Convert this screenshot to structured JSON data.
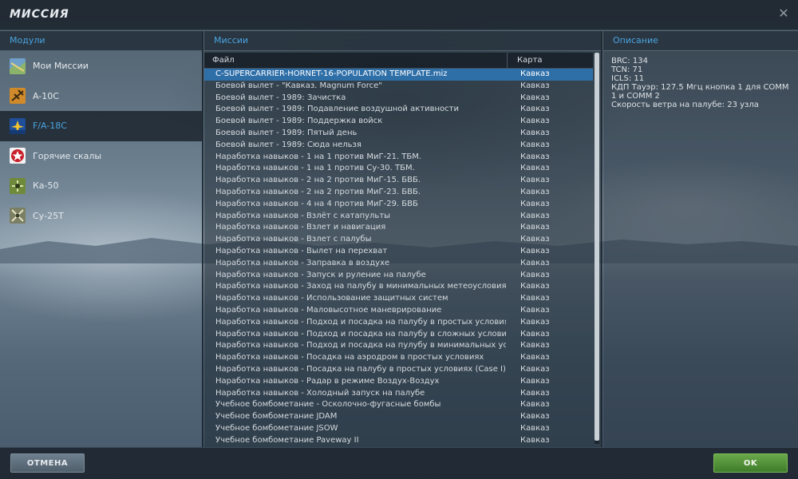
{
  "window": {
    "title": "МИССИЯ",
    "close_icon": "close-icon"
  },
  "columns": {
    "modules": "Модули",
    "missions": "Миссии",
    "description": "Описание"
  },
  "modules": [
    {
      "label": "Мои Миссии",
      "icon": "map-icon",
      "selected": false
    },
    {
      "label": "A-10C",
      "icon": "a10c-icon",
      "selected": false
    },
    {
      "label": "F/A-18C",
      "icon": "hornet-icon",
      "selected": true
    },
    {
      "label": "Горячие скалы",
      "icon": "star-icon",
      "selected": false
    },
    {
      "label": "Ка-50",
      "icon": "ka50-icon",
      "selected": false
    },
    {
      "label": "Су-25Т",
      "icon": "su25t-icon",
      "selected": false
    }
  ],
  "table": {
    "headers": {
      "file": "Файл",
      "map": "Карта"
    },
    "rows": [
      {
        "file": "C-SUPERCARRIER-HORNET-16-POPULATION TEMPLATE.miz",
        "map": "Кавказ",
        "selected": true
      },
      {
        "file": "Боевой вылет - \"Кавказ. Magnum Force\"",
        "map": "Кавказ"
      },
      {
        "file": "Боевой вылет - 1989: Зачистка",
        "map": "Кавказ"
      },
      {
        "file": "Боевой вылет - 1989: Подавление воздушной активности",
        "map": "Кавказ"
      },
      {
        "file": "Боевой вылет - 1989: Поддержка войск",
        "map": "Кавказ"
      },
      {
        "file": "Боевой вылет - 1989: Пятый день",
        "map": "Кавказ"
      },
      {
        "file": "Боевой вылет - 1989: Сюда нельзя",
        "map": "Кавказ"
      },
      {
        "file": "Наработка навыков - 1 на 1 против МиГ-21. ТБМ.",
        "map": "Кавказ"
      },
      {
        "file": "Наработка навыков - 1 на 1 против Су-30. ТБМ.",
        "map": "Кавказ"
      },
      {
        "file": "Наработка навыков - 2 на 2 против МиГ-15. БВБ.",
        "map": "Кавказ"
      },
      {
        "file": "Наработка навыков - 2 на 2 против МиГ-23. БВБ.",
        "map": "Кавказ"
      },
      {
        "file": "Наработка навыков - 4 на 4 против МиГ-29. БВБ",
        "map": "Кавказ"
      },
      {
        "file": "Наработка навыков - Взлёт с катапульты",
        "map": "Кавказ"
      },
      {
        "file": "Наработка навыков - Взлет и навигация",
        "map": "Кавказ"
      },
      {
        "file": "Наработка навыков - Взлет с палубы",
        "map": "Кавказ"
      },
      {
        "file": "Наработка навыков - Вылет на перехват",
        "map": "Кавказ"
      },
      {
        "file": "Наработка навыков - Заправка в воздухе",
        "map": "Кавказ"
      },
      {
        "file": "Наработка навыков - Запуск и руление на палубе",
        "map": "Кавказ"
      },
      {
        "file": "Наработка навыков - Заход на палубу в минимальных метеоусловиях (Case",
        "map": "Кавказ"
      },
      {
        "file": "Наработка навыков - Использование защитных систем",
        "map": "Кавказ"
      },
      {
        "file": "Наработка навыков - Маловысотное маневрирование",
        "map": "Кавказ"
      },
      {
        "file": "Наработка навыков - Подход и посадка на палубу в простых условиях (Case",
        "map": "Кавказ"
      },
      {
        "file": "Наработка навыков - Подход и посадка на палубу в сложных условиях (Case",
        "map": "Кавказ"
      },
      {
        "file": "Наработка навыков - Подход и посадка на пулубу в минимальных условиях",
        "map": "Кавказ"
      },
      {
        "file": "Наработка навыков - Посадка на аэродром в простых условиях",
        "map": "Кавказ"
      },
      {
        "file": "Наработка навыков - Посадка на палубу в простых условиях (Case I)",
        "map": "Кавказ"
      },
      {
        "file": "Наработка навыков - Радар в режиме Воздух-Воздух",
        "map": "Кавказ"
      },
      {
        "file": "Наработка навыков - Холодный запуск на палубе",
        "map": "Кавказ"
      },
      {
        "file": "Учебное бомбометание - Осколочно-фугасные бомбы",
        "map": "Кавказ"
      },
      {
        "file": "Учебное бомбометание JDAM",
        "map": "Кавказ"
      },
      {
        "file": "Учебное бомбометание JSOW",
        "map": "Кавказ"
      },
      {
        "file": "Учебное бомбометание Paveway II",
        "map": "Кавказ"
      }
    ]
  },
  "description": {
    "lines": [
      "BRC: 134",
      "TCN: 71",
      "ICLS: 11",
      "КДП Тауэр: 127.5 Мгц кнопка 1 для COMM 1 и COMM 2",
      "Скорость ветра на палубе: 23 узла"
    ]
  },
  "footer": {
    "cancel_label": "ОТМЕНА",
    "ok_label": "OK"
  },
  "colors": {
    "accent": "#4aa3e0",
    "selection": "#2f6fa8",
    "ok": "#4f9436"
  }
}
